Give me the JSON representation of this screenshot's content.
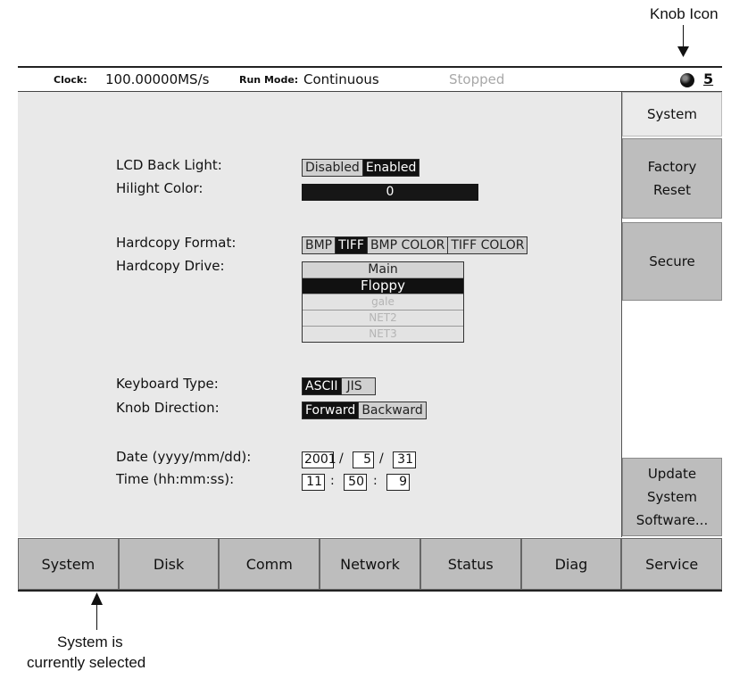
{
  "annotations": {
    "knob_icon": "Knob Icon",
    "system_selected_line1": "System is",
    "system_selected_line2": "currently selected"
  },
  "status_bar": {
    "clock_label": "Clock:",
    "clock_value": "100.00000MS/s",
    "run_mode_label": "Run Mode:",
    "run_mode_value": "Continuous",
    "run_state": "Stopped",
    "knob_number": "5"
  },
  "settings": {
    "lcd_backlight": {
      "label": "LCD Back Light:",
      "options": [
        "Disabled",
        "Enabled"
      ],
      "selected": "Enabled"
    },
    "hilight_color": {
      "label": "Hilight Color:",
      "value": "0"
    },
    "hardcopy_format": {
      "label": "Hardcopy Format:",
      "options": [
        "BMP",
        "TIFF",
        "BMP COLOR",
        "TIFF COLOR"
      ],
      "selected": "TIFF"
    },
    "hardcopy_drive": {
      "label": "Hardcopy Drive:",
      "options": [
        "Main",
        "Floppy",
        "gale",
        "NET2",
        "NET3"
      ],
      "selected": "Floppy"
    },
    "keyboard_type": {
      "label": "Keyboard Type:",
      "options": [
        "ASCII",
        "JIS"
      ],
      "selected": "ASCII"
    },
    "knob_direction": {
      "label": "Knob Direction:",
      "options": [
        "Forward",
        "Backward"
      ],
      "selected": "Forward"
    },
    "date": {
      "label": "Date (yyyy/mm/dd):",
      "year": "2001",
      "month": "5",
      "day": "31",
      "sep": "/"
    },
    "time": {
      "label": "Time (hh:mm:ss):",
      "hour": "11",
      "minute": "50",
      "second": "9",
      "sep": ":"
    }
  },
  "side_menu": {
    "title": "System",
    "factory_reset_1": "Factory",
    "factory_reset_2": "Reset",
    "secure": "Secure",
    "update_1": "Update",
    "update_2": "System",
    "update_3": "Software..."
  },
  "tabs": [
    "System",
    "Disk",
    "Comm",
    "Network",
    "Status",
    "Diag",
    "Service"
  ],
  "selected_tab": "System"
}
